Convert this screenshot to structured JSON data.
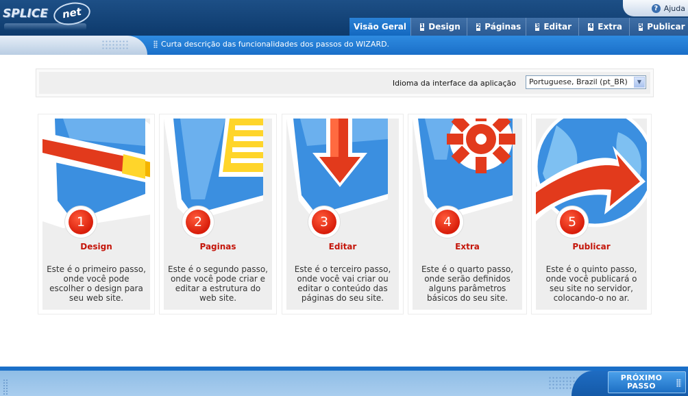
{
  "app": {
    "logo_text": "SPLICE",
    "logo_badge": "net"
  },
  "header": {
    "help_label": "Ajuda",
    "tabs": [
      {
        "label": "Visão Geral",
        "num": ""
      },
      {
        "label": "Design",
        "num": "1"
      },
      {
        "label": "Páginas",
        "num": "2"
      },
      {
        "label": "Editar",
        "num": "3"
      },
      {
        "label": "Extra",
        "num": "4"
      },
      {
        "label": "Publicar",
        "num": "5"
      }
    ],
    "active_tab": "Visão Geral",
    "description": "Curta descrição das funcionalidades dos passos do WIZARD."
  },
  "language": {
    "label": "Idioma da interface da aplicação",
    "selected": "Portuguese, Brazil (pt_BR)"
  },
  "steps": [
    {
      "num": "1",
      "title": "Design",
      "description": "Este é o primeiro passo, onde você pode escolher o design para seu web site."
    },
    {
      "num": "2",
      "title": "Paginas",
      "description": "Este é o segundo passo, onde você pode criar e editar a estrutura do web site."
    },
    {
      "num": "3",
      "title": "Editar",
      "description": "Este é o terceiro passo, onde você vai criar ou editar o conteúdo das páginas do seu site."
    },
    {
      "num": "4",
      "title": "Extra",
      "description": "Este é o quarto passo, onde serão definidos alguns parâmetros básicos do seu site."
    },
    {
      "num": "5",
      "title": "Publicar",
      "description": "Este é o quinto passo, onde você publicará o seu site no servidor, colocando-o no ar."
    }
  ],
  "footer": {
    "next_button": "PRÓXIMO PASSO"
  },
  "colors": {
    "brand_dark": "#0d3a6c",
    "tab_active": "#1368bf",
    "step_title": "#c4160b",
    "step_badge": "#d81d0a",
    "panel_blue": "#3b8fe0"
  }
}
